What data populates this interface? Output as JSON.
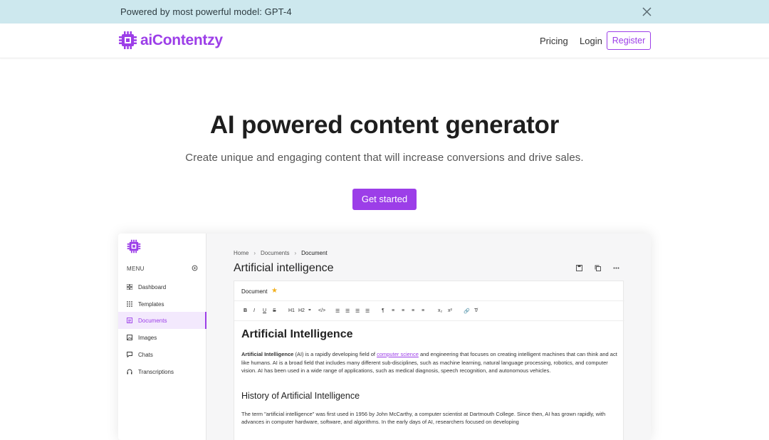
{
  "announcement": {
    "text": "Powered by most powerful model: GPT-4",
    "close_icon": "close-icon"
  },
  "nav": {
    "brand": "aiContentzy",
    "pricing": "Pricing",
    "login": "Login",
    "register": "Register"
  },
  "hero": {
    "title": "AI powered content generator",
    "subtitle": "Create unique and engaging content that will increase conversions and drive sales.",
    "cta": "Get started"
  },
  "colors": {
    "brand": "#9c3ee8",
    "announce_bg": "#cde8ee",
    "star": "#f2b01e"
  },
  "preview": {
    "menu_label": "MENU",
    "sidebar": [
      {
        "label": "Dashboard",
        "icon": "grid-icon"
      },
      {
        "label": "Templates",
        "icon": "dots-grid-icon"
      },
      {
        "label": "Documents",
        "icon": "document-icon",
        "active": true
      },
      {
        "label": "Images",
        "icon": "image-icon"
      },
      {
        "label": "Chats",
        "icon": "chat-icon"
      },
      {
        "label": "Transcriptions",
        "icon": "headphones-icon"
      }
    ],
    "breadcrumb": {
      "home": "Home",
      "documents": "Documents",
      "current": "Document"
    },
    "doc_title": "Artificial intelligence",
    "editor": {
      "doc_name": "Document",
      "toolbar": [
        "B",
        "I",
        "U",
        "S",
        "H1",
        "H2",
        "❞",
        "</>",
        "☰",
        "☰",
        "☰",
        "☰",
        "¶",
        "≡",
        "≡",
        "≡",
        "≡",
        "x₂",
        "x²",
        "🔗",
        "T̸"
      ],
      "heading": "Artificial Intelligence",
      "para1_bold": "Artificial Intelligence",
      "para1_a": " (AI) is a rapidly developing field of ",
      "para1_link": "computer science",
      "para1_b": " and engineering that focuses on creating intelligent machines that can think and act like humans. AI is a broad field that includes many different sub-disciplines, such as machine learning, natural language processing, robotics, and computer vision. AI has been used in a wide range of applications, such as medical diagnosis, speech recognition, and autonomous vehicles.",
      "heading2": "History of Artificial Intelligence",
      "para2": "The term \"artificial intelligence\" was first used in 1956 by John McCarthy, a computer scientist at Dartmouth College. Since then, AI has grown rapidly, with advances in computer hardware, software, and algorithms. In the early days of AI, researchers focused on developing"
    }
  }
}
